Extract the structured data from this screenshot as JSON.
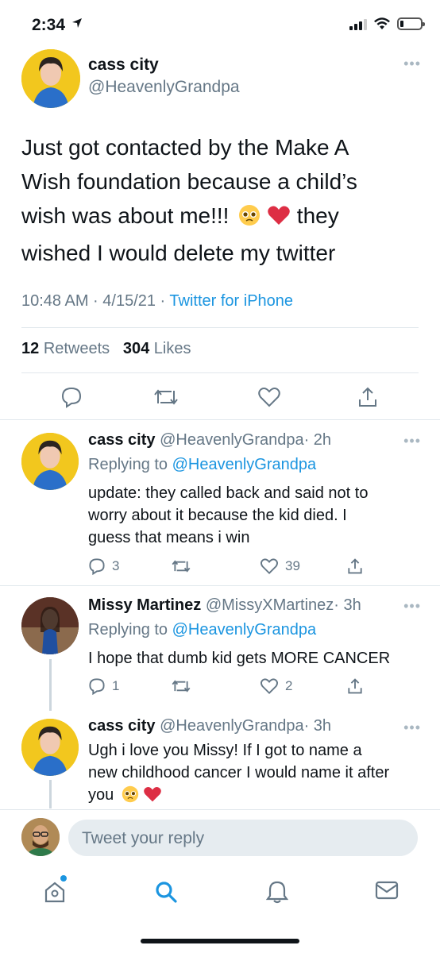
{
  "status_bar": {
    "time": "2:34",
    "location_icon": "location-arrow-icon",
    "signal_icon": "cellular-signal-icon",
    "wifi_icon": "wifi-icon",
    "battery_icon": "battery-low-icon"
  },
  "main_tweet": {
    "name": "cass city",
    "handle": "@HeavenlyGrandpa",
    "text_line1": "Just got contacted by the Make A",
    "text_line2": "Wish foundation because a child’s",
    "text_line3a": "wish was about me!!!",
    "text_line3b": "they",
    "text_line4": "wished I would delete my twitter",
    "time": "10:48 AM · 4/15/21 · ",
    "source": "Twitter for iPhone",
    "retweets_count": "12",
    "retweets_label": "Retweets",
    "likes_count": "304",
    "likes_label": "Likes"
  },
  "replies": [
    {
      "name": "cass city",
      "handle": "@HeavenlyGrandpa",
      "age": "· 2h",
      "replying_prefix": "Replying to ",
      "replying_to": "@HeavenlyGrandpa",
      "line1": "update: they called back and said not to",
      "line2": "worry about it because the kid died. I",
      "line3": "guess that means i win",
      "reply_count": "3",
      "retweet_count": "",
      "like_count": "39"
    },
    {
      "name": "Missy Martinez",
      "handle": "@MissyXMartinez",
      "age": "· 3h",
      "replying_prefix": "Replying to ",
      "replying_to": "@HeavenlyGrandpa",
      "line1": "I hope that dumb kid gets MORE CANCER",
      "reply_count": "1",
      "retweet_count": "",
      "like_count": "2"
    },
    {
      "name": "cass city",
      "handle": "@HeavenlyGrandpa",
      "age": "· 3h",
      "line1": "Ugh i love you Missy! If I got to name a",
      "line2": "new childhood cancer I would name it after",
      "line3": "you"
    }
  ],
  "composer": {
    "placeholder": "Tweet your reply"
  },
  "tab_bar": {
    "items": [
      "home-icon",
      "search-icon",
      "notifications-icon",
      "messages-icon"
    ]
  },
  "colors": {
    "accent": "#1b95e0",
    "muted": "#657786",
    "divider": "#e1e8ed",
    "like": "#e0245e"
  }
}
